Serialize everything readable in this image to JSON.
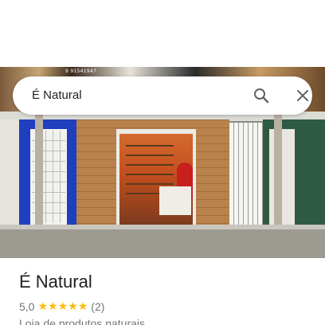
{
  "search": {
    "query": "É Natural",
    "search_icon": "search-icon",
    "close_icon": "close-icon"
  },
  "photo": {
    "sign_text": "9 91541947"
  },
  "place": {
    "title": "É Natural",
    "rating": "5,0",
    "stars": 5,
    "review_count": "(2)",
    "category": "Loja de produtos naturais"
  },
  "colors": {
    "star": "#fbbc04",
    "title_text": "#202124",
    "secondary_text": "#70757a"
  }
}
